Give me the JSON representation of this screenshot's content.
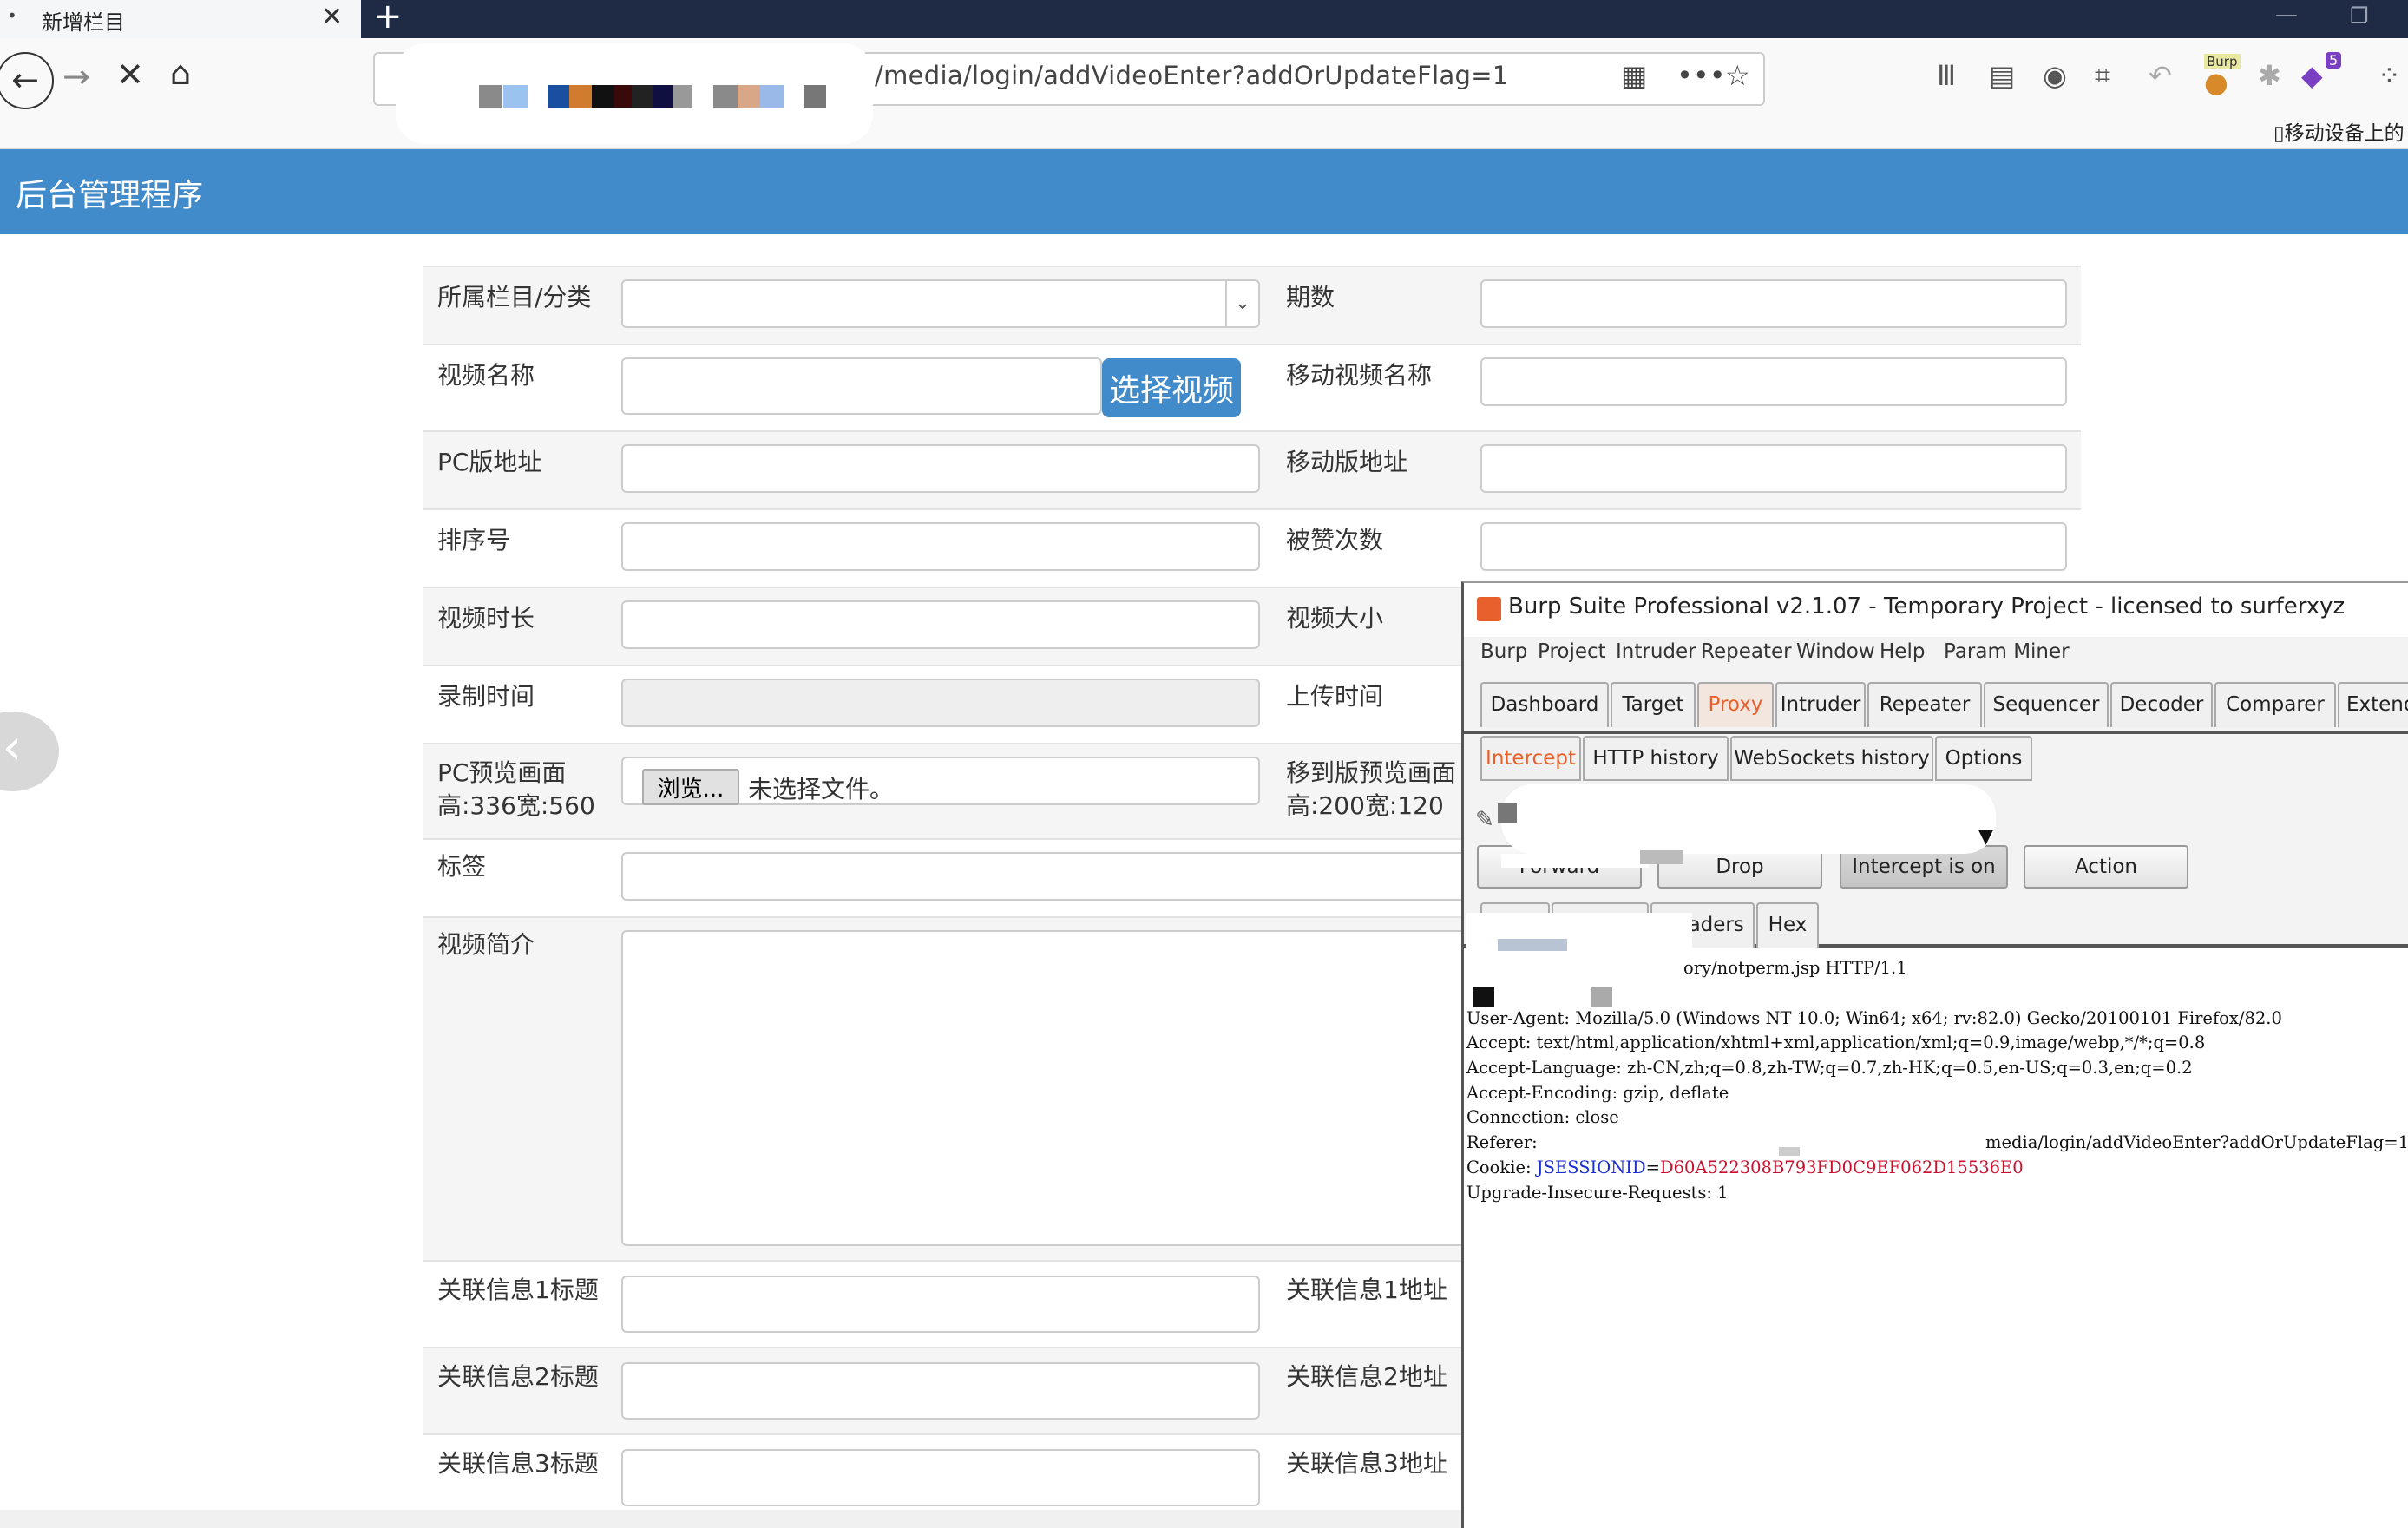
{
  "browser": {
    "tab_title": "新增栏目",
    "tab_dot": "•",
    "tab_close": "✕",
    "new_tab": "+",
    "url_visible": "/media/login/addVideoEnter?addOrUpdateFlag=1",
    "bookmark_mobile": "移动设备上的"
  },
  "app": {
    "title": "后台管理程序"
  },
  "form": {
    "column_category_label": "所属栏目/分类",
    "issue_label": "期数",
    "video_name_label": "视频名称",
    "choose_video_button": "选择视频",
    "mobile_video_name_label": "移动视频名称",
    "pc_url_label": "PC版地址",
    "mobile_url_label": "移动版地址",
    "sort_label": "排序号",
    "likes_label": "被赞次数",
    "duration_label": "视频时长",
    "size_label": "视频大小",
    "record_time_label": "录制时间",
    "upload_time_label": "上传时间",
    "pc_preview_label_1": "PC预览画面",
    "pc_preview_label_2": "高:336宽:560",
    "browse_button": "浏览...",
    "no_file_text": "未选择文件。",
    "mobile_preview_label_1": "移到版预览画面",
    "mobile_preview_label_2": "高:200宽:120",
    "tags_label": "标签",
    "intro_label": "视频简介",
    "related1_title_label": "关联信息1标题",
    "related1_url_label": "关联信息1地址",
    "related2_title_label": "关联信息2标题",
    "related2_url_label": "关联信息2地址",
    "related3_title_label": "关联信息3标题",
    "related3_url_label": "关联信息3地址"
  },
  "burp": {
    "title": "Burp Suite Professional v2.1.07 - Temporary Project - licensed to surferxyz",
    "menu": [
      "Burp",
      "Project",
      "Intruder",
      "Repeater",
      "Window",
      "Help",
      "Param Miner"
    ],
    "tabs": [
      "Dashboard",
      "Target",
      "Proxy",
      "Intruder",
      "Repeater",
      "Sequencer",
      "Decoder",
      "Comparer",
      "Extend"
    ],
    "active_tab": "Proxy",
    "subtabs": [
      "Intercept",
      "HTTP history",
      "WebSockets history",
      "Options"
    ],
    "active_subtab": "Intercept",
    "buttons": {
      "forward": "Forward",
      "drop": "Drop",
      "intercept": "Intercept is on",
      "action": "Action"
    },
    "view_tabs": [
      "Headers",
      "Hex"
    ],
    "request": {
      "line1_visible": "ory/notperm.jsp HTTP/1.1",
      "user_agent": "User-Agent: Mozilla/5.0 (Windows NT 10.0; Win64; x64; rv:82.0) Gecko/20100101 Firefox/82.0",
      "accept": "Accept: text/html,application/xhtml+xml,application/xml;q=0.9,image/webp,*/*;q=0.8",
      "accept_language": "Accept-Language: zh-CN,zh;q=0.8,zh-TW;q=0.7,zh-HK;q=0.5,en-US;q=0.3,en;q=0.2",
      "accept_encoding": "Accept-Encoding: gzip, deflate",
      "connection": "Connection: close",
      "referer_label": "Referer:",
      "referer_visible": "media/login/addVideoEnter?addOrUpdateFlag=1",
      "cookie_label": "Cookie: ",
      "cookie_name": "JSESSIONID",
      "cookie_eq": "=",
      "cookie_value": "D60A522308B793FD0C9EF062D15536E0",
      "upgrade": "Upgrade-Insecure-Requests: 1"
    }
  },
  "colors": {
    "app_header": "#428bca",
    "burp_accent": "#e8612c",
    "tabbar_dark": "#1f2a44"
  }
}
